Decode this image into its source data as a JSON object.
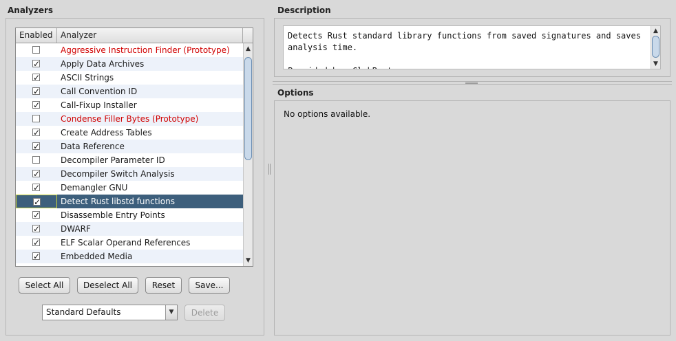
{
  "analyzers": {
    "title": "Analyzers",
    "columns": {
      "enabled": "Enabled",
      "analyzer": "Analyzer"
    },
    "rows": [
      {
        "name": "Aggressive Instruction Finder (Prototype)",
        "enabled": false,
        "prototype": true
      },
      {
        "name": "Apply Data Archives",
        "enabled": true,
        "prototype": false
      },
      {
        "name": "ASCII Strings",
        "enabled": true,
        "prototype": false
      },
      {
        "name": "Call Convention ID",
        "enabled": true,
        "prototype": false
      },
      {
        "name": "Call-Fixup Installer",
        "enabled": true,
        "prototype": false
      },
      {
        "name": "Condense Filler Bytes (Prototype)",
        "enabled": false,
        "prototype": true
      },
      {
        "name": "Create Address Tables",
        "enabled": true,
        "prototype": false
      },
      {
        "name": "Data Reference",
        "enabled": true,
        "prototype": false
      },
      {
        "name": "Decompiler Parameter ID",
        "enabled": false,
        "prototype": false
      },
      {
        "name": "Decompiler Switch Analysis",
        "enabled": true,
        "prototype": false
      },
      {
        "name": "Demangler GNU",
        "enabled": true,
        "prototype": false
      },
      {
        "name": "Detect Rust libstd functions",
        "enabled": true,
        "prototype": false,
        "selected": true
      },
      {
        "name": "Disassemble Entry Points",
        "enabled": true,
        "prototype": false
      },
      {
        "name": "DWARF",
        "enabled": true,
        "prototype": false
      },
      {
        "name": "ELF Scalar Operand References",
        "enabled": true,
        "prototype": false
      },
      {
        "name": "Embedded Media",
        "enabled": true,
        "prototype": false
      }
    ],
    "buttons": {
      "select_all": "Select All",
      "deselect_all": "Deselect All",
      "reset": "Reset",
      "save": "Save..."
    },
    "profile": {
      "selected": "Standard Defaults"
    },
    "delete_label": "Delete"
  },
  "description": {
    "title": "Description",
    "text": "Detects Rust standard library functions from saved signatures and saves analysis time.\n\nProvided by: ClubRust"
  },
  "options": {
    "title": "Options",
    "text": "No options available."
  },
  "colors": {
    "selection": "#3d5f7c",
    "prototype_text": "#d00000",
    "alt_row": "#edf2fa"
  }
}
